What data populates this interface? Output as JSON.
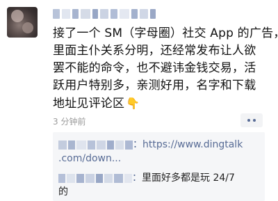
{
  "post": {
    "lines": [
      "接了一个 SM（字母圈）社交 App 的广告，",
      "里面主仆关系分明，还经常发布让人欲",
      "罢不能的命令，也不避讳金钱交易，活",
      "跃用户特别多，亲测好用，名字和下载",
      "地址见评论区"
    ],
    "emoji": "👇",
    "time": "3 分钟前"
  },
  "icons": {
    "more": "more-dots-icon",
    "hand": "pointing-down-icon"
  },
  "comments": [
    {
      "colon": "：",
      "text_line1": "https://www.dingtalk",
      "text_line2": ".com/down..."
    },
    {
      "colon": "：",
      "text_line1": "里面好多都是玩 24/7",
      "text_line2": "的"
    }
  ],
  "colors": {
    "link": "#576b95",
    "time": "#9b9b9b",
    "comment_bg": "#f5f6f8"
  }
}
